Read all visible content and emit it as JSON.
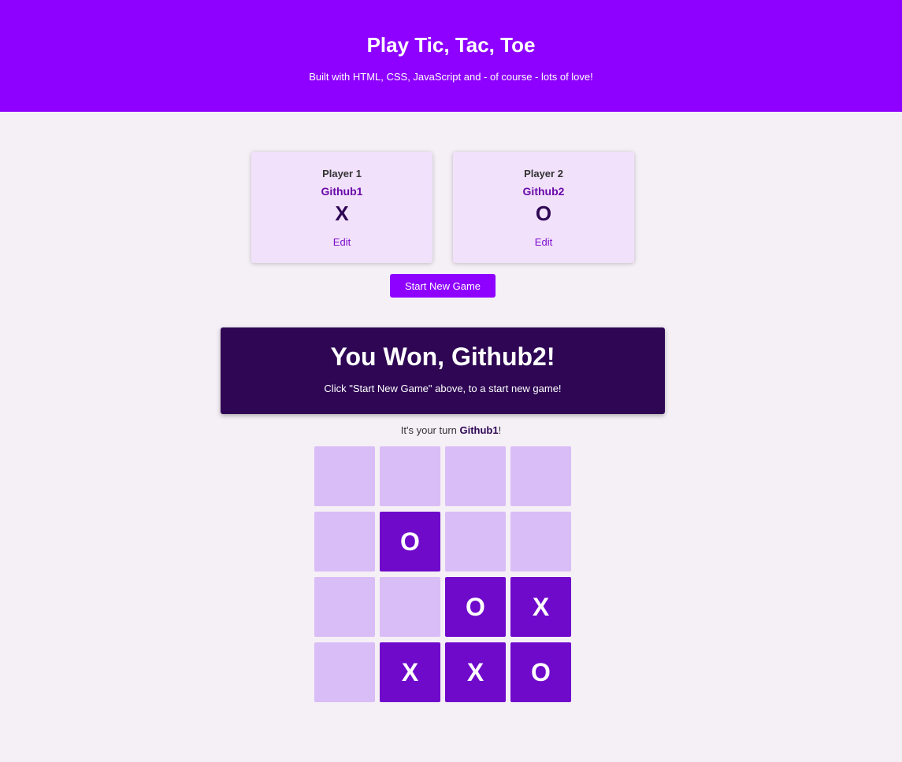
{
  "header": {
    "title": "Play Tic, Tac, Toe",
    "subtitle": "Built with HTML, CSS, JavaScript and - of course - lots of love!"
  },
  "players": [
    {
      "label": "Player 1",
      "name": "Github1",
      "symbol": "X",
      "edit_label": "Edit"
    },
    {
      "label": "Player 2",
      "name": "Github2",
      "symbol": "O",
      "edit_label": "Edit"
    }
  ],
  "start_button_label": "Start New Game",
  "game_over": {
    "title": "You Won, Github2!",
    "message": "Click \"Start New Game\" above, to a start new game!"
  },
  "turn": {
    "prefix": "It's your turn ",
    "player": "Github1",
    "suffix": "!"
  },
  "board": [
    [
      "",
      "",
      "",
      ""
    ],
    [
      "",
      "O",
      "",
      ""
    ],
    [
      "",
      "",
      "O",
      "X"
    ],
    [
      "",
      "X",
      "X",
      "O"
    ]
  ],
  "colors": {
    "header": "#8e00ff",
    "card": "#f1e1fb",
    "game_over": "#2e0654",
    "cell_empty": "#d9bdf6",
    "cell_filled": "#6f0acb"
  }
}
